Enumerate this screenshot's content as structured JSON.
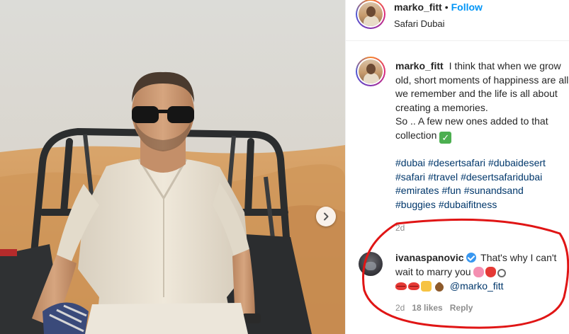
{
  "post": {
    "username": "marko_fitt",
    "dot": "•",
    "follow_label": "Follow",
    "location": "Safari Dubai"
  },
  "caption": {
    "username": "marko_fitt",
    "text": "I think that when we grow old, short moments of happiness are all we remember and the life is all about creating a memories.",
    "text2": "So .. A few new ones added to that collection",
    "emoji": "check-mark-button-emoji"
  },
  "hashtags": [
    "#dubai",
    "#desertsafari",
    "#dubaidesert",
    "#safari",
    "#travel",
    "#desertsafaridubai",
    "#emirates",
    "#fun",
    "#sunandsand",
    "#buggies",
    "#dubaifitness"
  ],
  "post_time": "2d",
  "comment": {
    "username": "ivanaspanovic",
    "verified": true,
    "text": "That's why I can't wait to marry you",
    "mention": "@marko_fitt",
    "time": "2d",
    "likes": "18 likes",
    "reply_label": "Reply"
  },
  "colors": {
    "link_blue": "#0095f6",
    "hashtag": "#00376b",
    "muted": "#8e8e8e",
    "annotation_red": "#e01515"
  },
  "icons": {
    "next": "chevron-right-icon",
    "verified": "verified-badge-icon"
  }
}
